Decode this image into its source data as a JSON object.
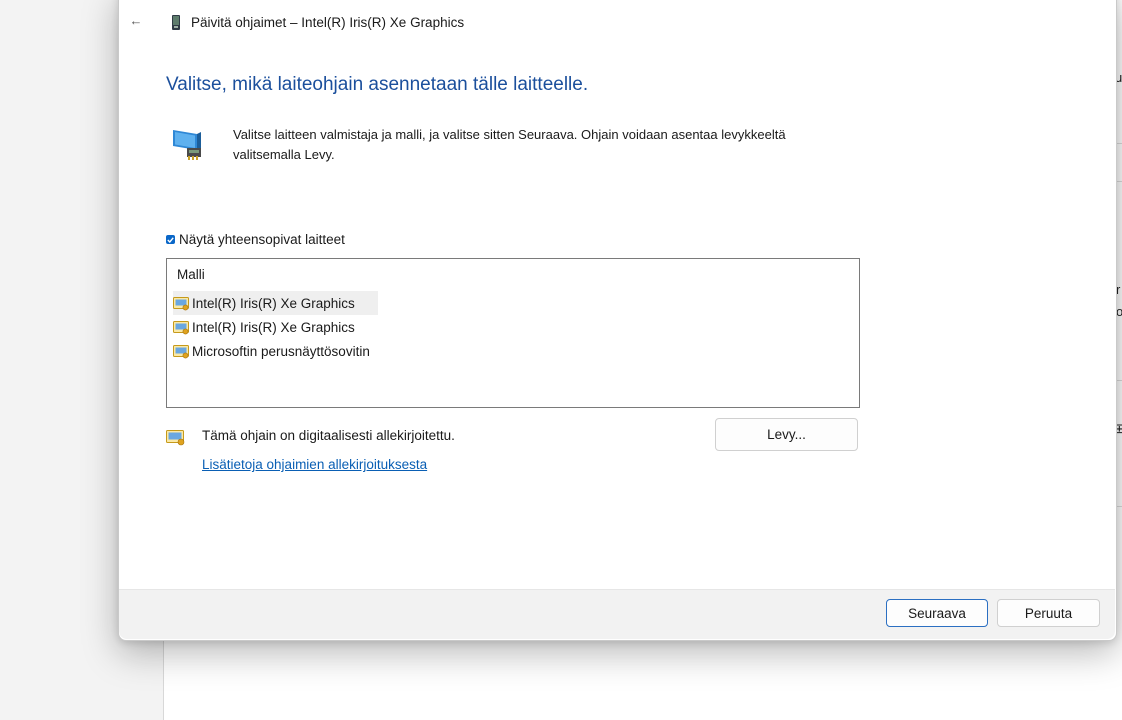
{
  "background_window": {
    "fragments": [
      "u",
      "r",
      "o",
      "⊞"
    ]
  },
  "dialog": {
    "title": "Päivitä ohjaimet – Intel(R) Iris(R) Xe Graphics",
    "heading": "Valitse, mikä laiteohjain asennetaan tälle laitteelle.",
    "intro_line1": "Valitse laitteen valmistaja ja malli, ja valitse sitten Seuraava. Ohjain voidaan asentaa levykkeeltä",
    "intro_line2": "valitsemalla Levy.",
    "show_compatible_label": "Näytä yhteensopivat laitteet",
    "show_compatible_checked": true,
    "list": {
      "header": "Malli",
      "items": [
        {
          "label": "Intel(R) Iris(R) Xe Graphics",
          "selected": true
        },
        {
          "label": "Intel(R) Iris(R) Xe Graphics",
          "selected": false
        },
        {
          "label": "Microsoftin perusnäyttösovitin",
          "selected": false
        }
      ]
    },
    "signed_text": "Tämä ohjain on digitaalisesti allekirjoitettu.",
    "signed_link": "Lisätietoja ohjaimien allekirjoituksesta",
    "disk_button": "Levy...",
    "next_button": "Seuraava",
    "cancel_button": "Peruuta"
  },
  "colors": {
    "accent": "#0a67c8",
    "heading": "#1b4f9c",
    "link": "#0a5fb4"
  }
}
